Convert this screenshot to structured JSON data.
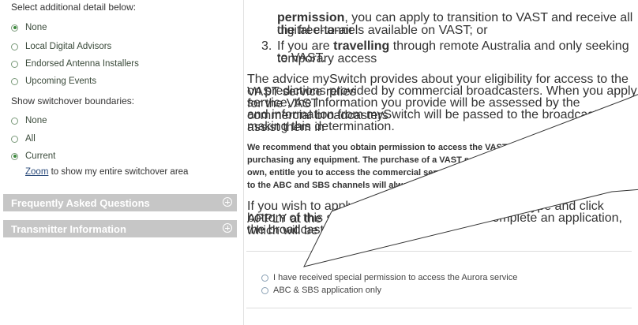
{
  "sidebar": {
    "cut_title": "Select additional detail below:",
    "detail_options": [
      {
        "label": "None",
        "selected": true
      },
      {
        "label": "Local Digital Advisors",
        "selected": false
      },
      {
        "label": "Endorsed Antenna Installers",
        "selected": false
      },
      {
        "label": "Upcoming Events",
        "selected": false
      }
    ],
    "boundaries_label": "Show switchover boundaries:",
    "boundary_options": [
      {
        "label": "None",
        "selected": false
      },
      {
        "label": "All",
        "selected": false
      },
      {
        "label": "Current",
        "selected": true
      }
    ],
    "zoom_link": "Zoom",
    "zoom_text": " to show my entire switchover area",
    "panels": [
      {
        "label": "Frequently Asked Questions"
      },
      {
        "label": "Transmitter Information"
      }
    ]
  },
  "main": {
    "item2_bold": "permission",
    "item2_rest": ", you can apply to transition to VAST and receive all the free-to-air",
    "item2_line2": "digital channels available on VAST; or",
    "item3_num": "3.",
    "item3_pre": "If you are ",
    "item3_bold": "travelling",
    "item3_rest": " through remote Australia and only seeking temporary access",
    "item3_line2": "to VAST.",
    "advice_l1": "The advice mySwitch provides about your eligibility for access to the VAST service relies",
    "advice_l2": "on predictions provided by commercial broadcasters. When you apply for the VAST",
    "advice_l3": "service, the information you provide will be assessed by the commercial broadcasters",
    "advice_l4": "and information from mySwitch will be passed to the broadcasters to assist them in",
    "advice_l5": "making this determination.",
    "rec_l1": "We recommend that you obtain permission to access the VAST service prior to",
    "rec_l2": "purchasing any equipment. The purchase of a VAST set-top box will not, on its",
    "rec_l3": "own, entitle you to access the commercial services on VAST. However, access",
    "rec_l4": "to the ABC and SBS channels will always be granted for h",
    "apply_l1": "If you wish to apply please select your application type and click APPLY at the",
    "apply_l2": "bottom of this screen. You will be asked to complete an application, which will be sent to",
    "apply_l3": "the broadcasters.",
    "application_options": [
      {
        "label": "I have received special permission to access the Aurora service",
        "selected": false
      },
      {
        "label": "ABC & SBS application only",
        "selected": false
      }
    ]
  },
  "colors": {
    "panel_bg": "#c6c6c6",
    "radio_selected": "#3c8a3c",
    "link": "#2a4a7a"
  }
}
